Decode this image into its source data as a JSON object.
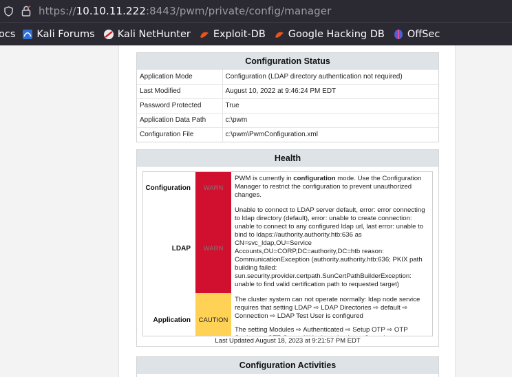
{
  "browser": {
    "url_scheme": "https://",
    "url_host": "10.10.11.222",
    "url_rest": ":8443/pwm/private/config/manager",
    "bookmarks": [
      {
        "label": "ocs",
        "icon": "docs-icon"
      },
      {
        "label": "Kali Forums",
        "icon": "kali-forums-icon"
      },
      {
        "label": "Kali NetHunter",
        "icon": "kali-nethunter-icon"
      },
      {
        "label": "Exploit-DB",
        "icon": "exploit-db-icon"
      },
      {
        "label": "Google Hacking DB",
        "icon": "google-hacking-db-icon"
      },
      {
        "label": "OffSec",
        "icon": "offsec-icon"
      }
    ]
  },
  "config_status": {
    "title": "Configuration Status",
    "rows": [
      {
        "key": "Application Mode",
        "value": "Configuration (LDAP directory authentication not required)"
      },
      {
        "key": "Last Modified",
        "value": "August 10, 2022 at 9:46:24 PM EDT"
      },
      {
        "key": "Password Protected",
        "value": "True"
      },
      {
        "key": "Application Data Path",
        "value": "c:\\pwm"
      },
      {
        "key": "Configuration File",
        "value": "c:\\pwm\\PwmConfiguration.xml"
      }
    ]
  },
  "health": {
    "title": "Health",
    "items": [
      {
        "name": "Configuration",
        "status": "WARN",
        "status_color": "#d0102e",
        "messages": [
          "PWM is currently in configuration mode. Use the Configuration Manager to restrict the configuration to prevent unauthorized changes."
        ]
      },
      {
        "name": "LDAP",
        "status": "WARN",
        "status_color": "#d0102e",
        "messages": [
          "Unable to connect to LDAP server default, error: error connecting to ldap directory (default), error: unable to create connection: unable to connect to any configured ldap url, last error: unable to bind to ldaps://authority.authority.htb:636 as CN=svc_ldap,OU=Service Accounts,OU=CORP,DC=authority,DC=htb reason: CommunicationException (authority.authority.htb:636; PKIX path building failed: sun.security.provider.certpath.SunCertPathBuilderException: unable to find valid certification path to requested target)"
        ]
      },
      {
        "name": "Application",
        "status": "CAUTION",
        "status_color": "#ffd155",
        "messages": [
          "The cluster system can not operate normally: ldap node service requires that setting LDAP ⇨ LDAP Directories ⇨ default ⇨ Connection ⇨ LDAP Test User is configured",
          "The setting Modules ⇨ Authenticated ⇨ Setup OTP ⇨ OTP Settings ⇨ OTP Secret Write Location is configured to store user"
        ]
      }
    ],
    "last_updated": "Last Updated August 18, 2023 at 9:21:57 PM EDT"
  },
  "activities": {
    "title": "Configuration Activities"
  }
}
